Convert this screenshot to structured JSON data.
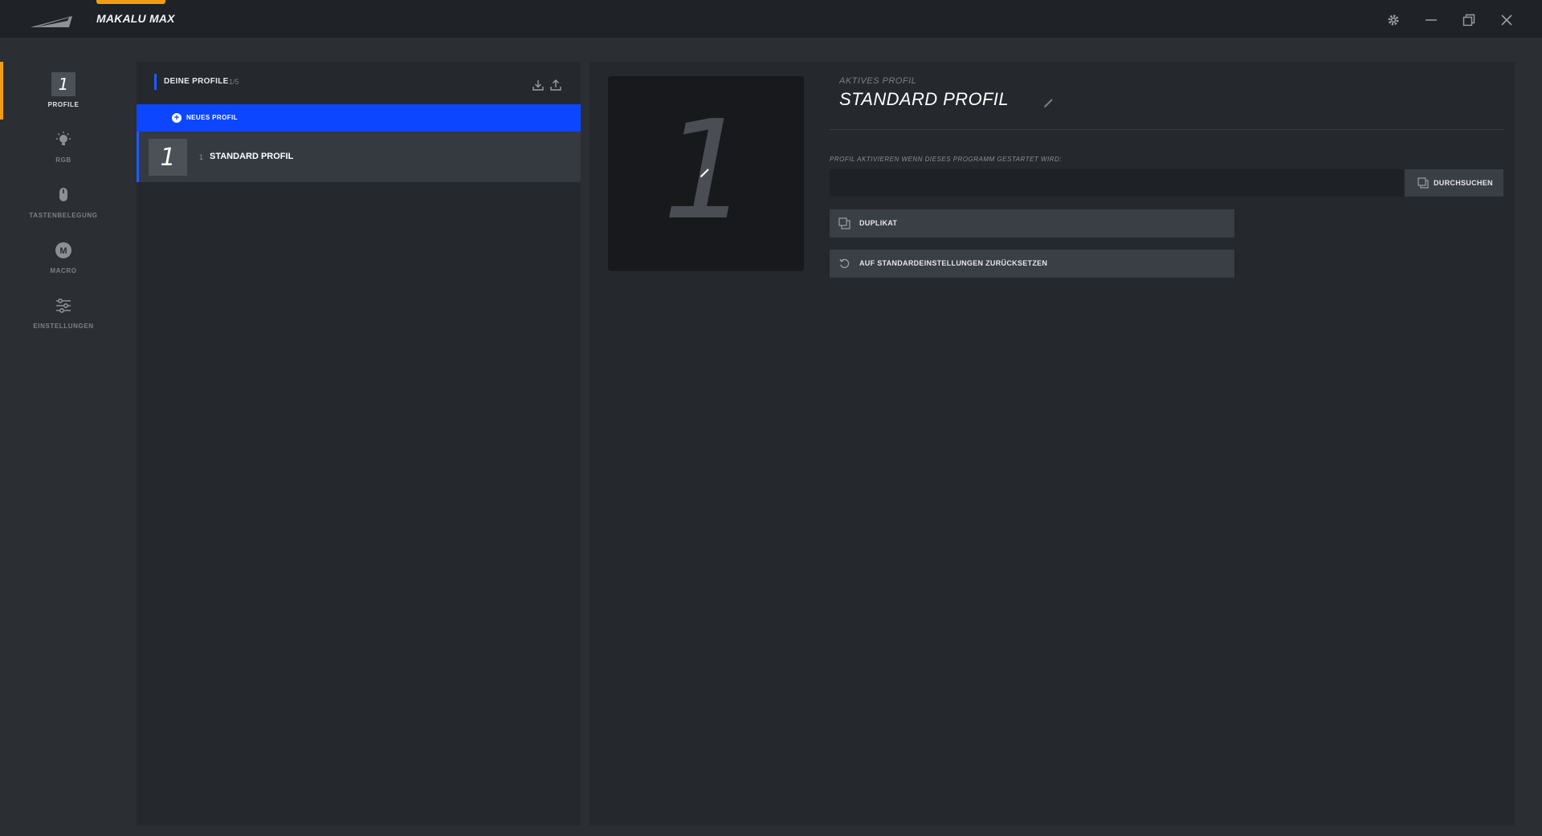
{
  "app": {
    "title": "MAKALU MAX",
    "accent_color": "#f39c12",
    "window_controls": [
      "gear-icon",
      "minimize-icon",
      "restore-icon",
      "close-icon"
    ]
  },
  "nav": {
    "items": [
      {
        "label": "PROFILE",
        "icon": "profile-number-icon",
        "badge": "1",
        "active": true
      },
      {
        "label": "RGB",
        "icon": "bulb-icon",
        "active": false
      },
      {
        "label": "TASTENBELEGUNG",
        "icon": "mouse-icon",
        "active": false
      },
      {
        "label": "MACRO",
        "icon": "macro-icon",
        "badge": "M",
        "active": false
      },
      {
        "label": "EINSTELLUNGEN",
        "icon": "sliders-icon",
        "active": false
      }
    ]
  },
  "profiles": {
    "title": "DEINE PROFILE",
    "count": "1/5",
    "new_profile_label": "NEUES PROFIL",
    "new_profile_color": "#0c47ff",
    "items": [
      {
        "badge": "1",
        "number": "1",
        "name": "STANDARD PROFIL"
      }
    ]
  },
  "main": {
    "preview_number": "1",
    "active_label": "AKTIVES PROFIL",
    "active_name": "STANDARD PROFIL",
    "activate_label": "PROFIL AKTIVIEREN WENN DIESES PROGRAMM GESTARTET WIRD:",
    "program_value": "",
    "browse_label": "DURCHSUCHEN",
    "duplicate_label": "DUPLIKAT",
    "reset_label": "AUF STANDARDEINSTELLUNGEN ZURÜCKSETZEN"
  }
}
